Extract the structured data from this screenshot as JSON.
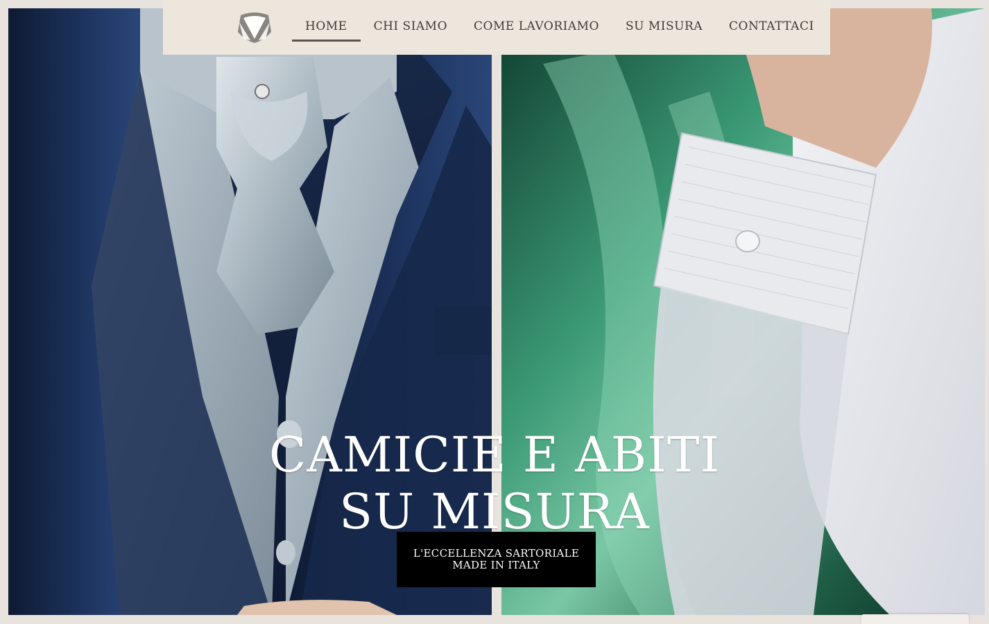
{
  "nav": {
    "logo_icon": "tuxedo-collar-icon",
    "items": [
      {
        "label": "HOME",
        "active": true
      },
      {
        "label": "CHI SIAMO",
        "active": false
      },
      {
        "label": "COME LAVORIAMO",
        "active": false
      },
      {
        "label": "SU MISURA",
        "active": false
      },
      {
        "label": "CONTATTACI",
        "active": false
      }
    ]
  },
  "hero": {
    "title_line1": "CAMICIE E ABITI",
    "title_line2": "SU MISURA",
    "cta_line1": "L'ECCELLENZA SARTORIALE",
    "cta_line2": "MADE IN ITALY"
  },
  "colors": {
    "background": "#e8e3dc",
    "navbar": "#ece6dd",
    "nav_text": "#3f3a36",
    "cta_background": "#000000",
    "hero_text": "#ffffff"
  }
}
